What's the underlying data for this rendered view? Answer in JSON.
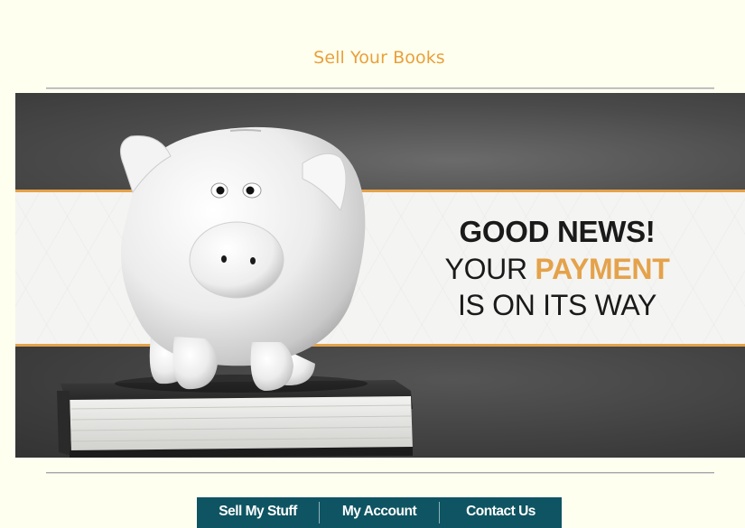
{
  "header": {
    "link_label": "Sell Your Books"
  },
  "banner": {
    "headline_line1": "GOOD NEWS!",
    "headline_line2_prefix": "YOUR ",
    "headline_line2_accent": "PAYMENT",
    "headline_line3": "IS ON ITS WAY",
    "accent_color": "#e4a24a",
    "image_subject": "piggy-bank-on-book"
  },
  "nav": {
    "items": [
      {
        "label": "Sell My Stuff"
      },
      {
        "label": "My Account"
      },
      {
        "label": "Contact Us"
      }
    ],
    "background_color": "#0f5462"
  }
}
